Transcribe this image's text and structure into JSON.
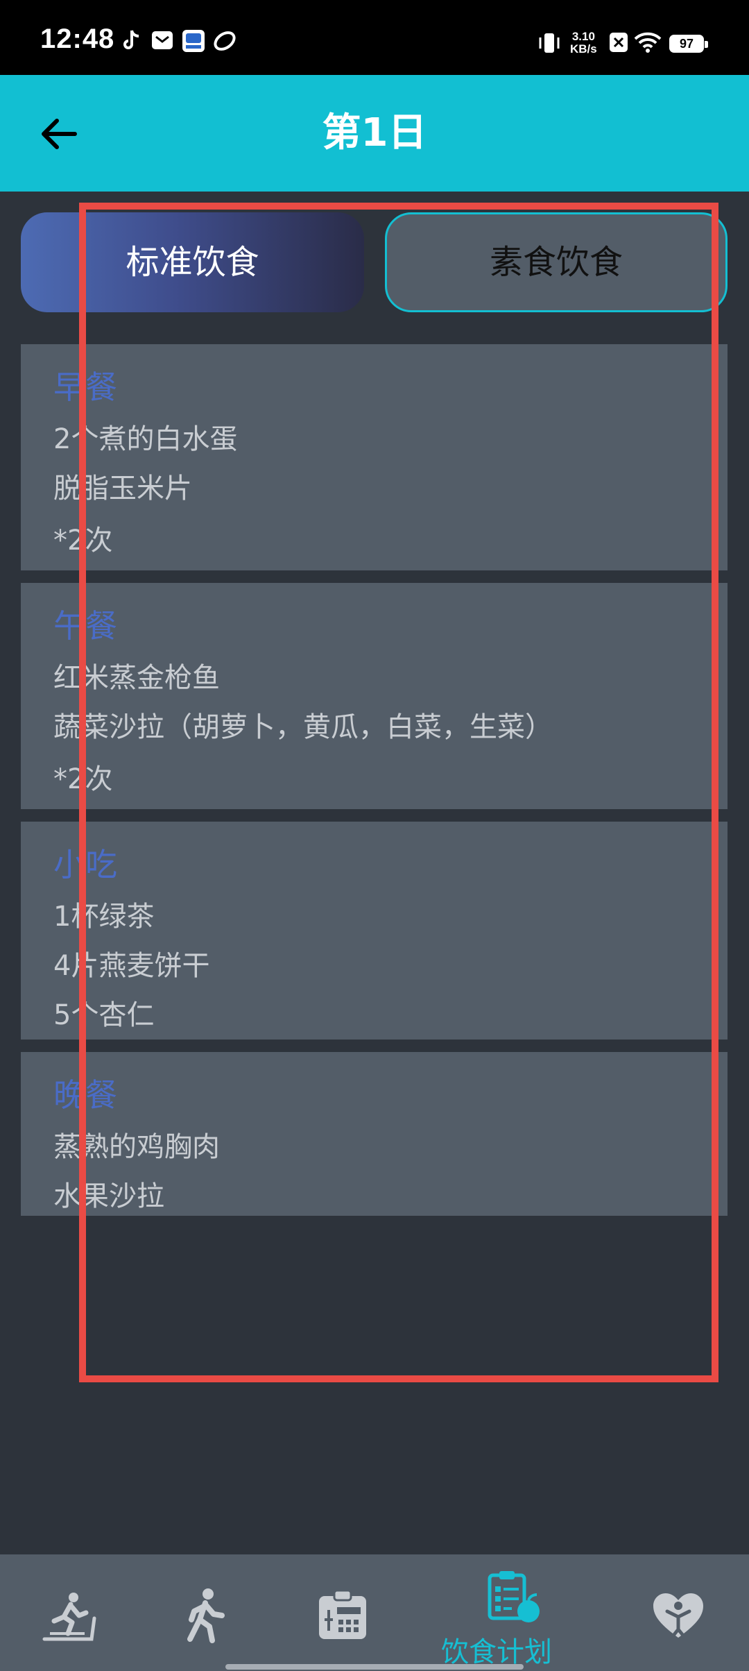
{
  "status_bar": {
    "time": "12:48",
    "net_speed_value": "3.10",
    "net_speed_unit": "KB/s",
    "battery": "97"
  },
  "header": {
    "title": "第1日"
  },
  "tabs": [
    {
      "label": "标准饮食",
      "selected": true
    },
    {
      "label": "素食饮食",
      "selected": false
    }
  ],
  "meals": [
    {
      "title": "早餐",
      "items": [
        "2个煮的白水蛋",
        "脱脂玉米片",
        "*2次"
      ]
    },
    {
      "title": "午餐",
      "items": [
        "红米蒸金枪鱼",
        "蔬菜沙拉（胡萝卜，黄瓜，白菜，生菜）",
        "*2次"
      ]
    },
    {
      "title": "小吃",
      "items": [
        "1杯绿茶",
        "4片燕麦饼干",
        "5个杏仁"
      ]
    },
    {
      "title": "晚餐",
      "items": [
        "蒸熟的鸡胸肉",
        "水果沙拉"
      ]
    }
  ],
  "bottom_nav": {
    "active_label": "饮食计划",
    "icons": [
      "treadmill-icon",
      "walking-icon",
      "calculator-icon",
      "diet-plan-icon",
      "heart-person-icon"
    ]
  },
  "colors": {
    "header": "#12bfd2",
    "background": "#2d333b",
    "card": "#535d68",
    "meal_title": "#4a6cc7",
    "active_nav": "#16bfd3",
    "highlight": "#ea4b45"
  }
}
